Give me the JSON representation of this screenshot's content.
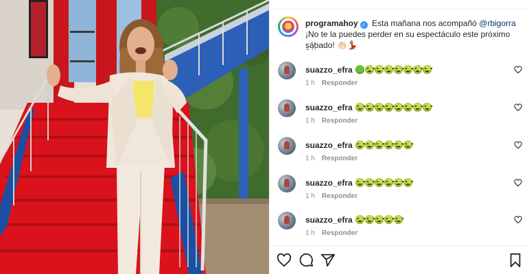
{
  "post": {
    "username": "programahoy",
    "caption_prefix": "Esta mañana nos acompañó",
    "mention": "@rbigorra",
    "caption_suffix": "¡No te la puedes perder en su espectáculo este próximo sábado!",
    "caption_emojis": "👏🏻💃🏻",
    "time": "1 h"
  },
  "comments": [
    {
      "user": "suazzo_efra",
      "emojis": [
        "green",
        "sick",
        "sick",
        "sick",
        "sick",
        "sick",
        "sick",
        "sick"
      ],
      "time": "1 h",
      "reply_label": "Responder"
    },
    {
      "user": "suazzo_efra",
      "emojis": [
        "sick",
        "sick",
        "sick",
        "sick",
        "sick",
        "sick",
        "sick",
        "sick"
      ],
      "time": "1 h",
      "reply_label": "Responder"
    },
    {
      "user": "suazzo_efra",
      "emojis": [
        "sick",
        "sick",
        "sick",
        "sick",
        "sick",
        "sick"
      ],
      "time": "1 h",
      "reply_label": "Responder"
    },
    {
      "user": "suazzo_efra",
      "emojis": [
        "sick",
        "sick",
        "sick",
        "sick",
        "sick",
        "sick"
      ],
      "time": "1 h",
      "reply_label": "Responder"
    },
    {
      "user": "suazzo_efra",
      "emojis": [
        "sick",
        "sick",
        "sick",
        "sick",
        "sick"
      ],
      "time": "1 h",
      "reply_label": "Responder"
    }
  ],
  "actions": {
    "icons": [
      "heart-icon",
      "comment-icon",
      "share-icon",
      "bookmark-icon"
    ]
  },
  "colors": {
    "stair_red": "#d9121b",
    "stair_side_blue": "#1b4fa3",
    "accent_link": "#00376b",
    "meta_gray": "#8e8e8e"
  }
}
